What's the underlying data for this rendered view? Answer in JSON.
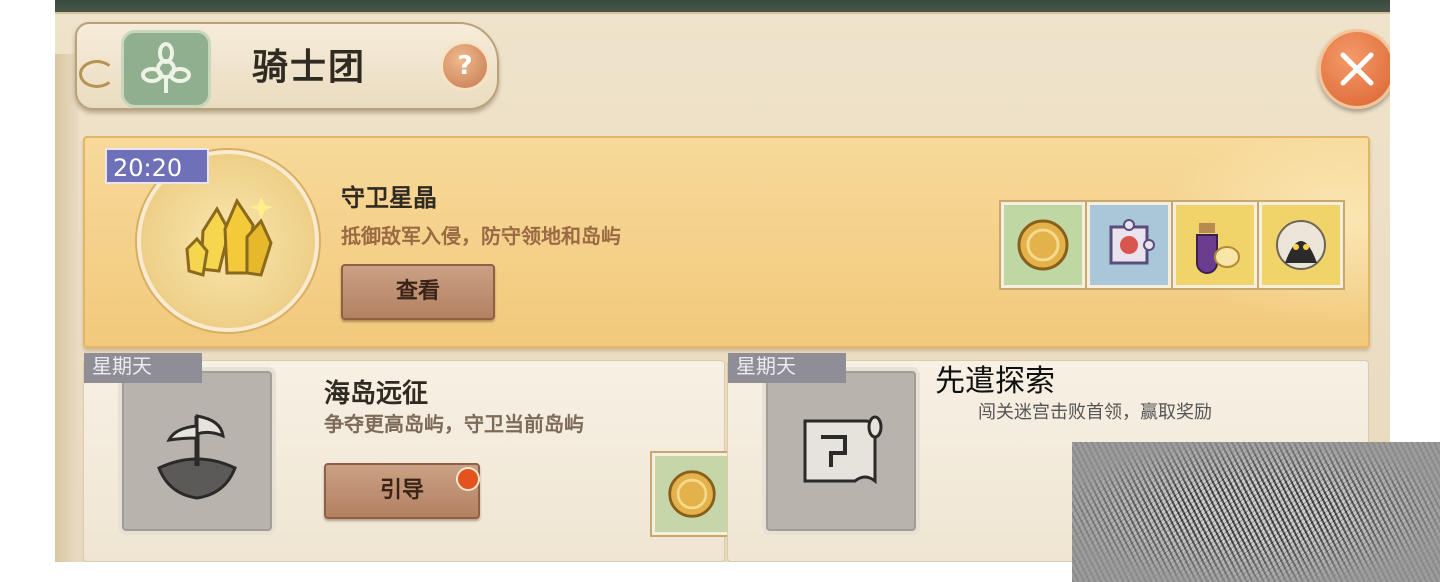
{
  "header": {
    "title": "骑士团",
    "help_icon": "?",
    "close_icon": "close-icon",
    "emblem_icon": "guild-emblem-icon"
  },
  "event": {
    "timer": "20:20",
    "title": "守卫星晶",
    "description": "抵御敌军入侵，防守领地和岛屿",
    "button_label": "查看",
    "emblem_icon": "crystal-icon",
    "rewards": [
      {
        "icon": "gold-coin-icon",
        "bg": "#bfd7a3"
      },
      {
        "icon": "puzzle-map-icon",
        "bg": "#a9c7d8"
      },
      {
        "icon": "potion-icon",
        "bg": "#f0d46a"
      },
      {
        "icon": "hooded-figure-icon",
        "bg": "#f0d46a"
      }
    ]
  },
  "cards": [
    {
      "day": "星期天",
      "title": "海岛远征",
      "description": "争夺更高岛屿，守卫当前岛屿",
      "button_label": "引导",
      "icon": "floating-island-icon",
      "reward_icon": "gold-coin-icon",
      "has_notification": true
    },
    {
      "day": "星期天",
      "title": "先遣探索",
      "description": "闯关迷宫击败首领，赢取奖励",
      "icon": "map-scroll-icon"
    }
  ]
}
